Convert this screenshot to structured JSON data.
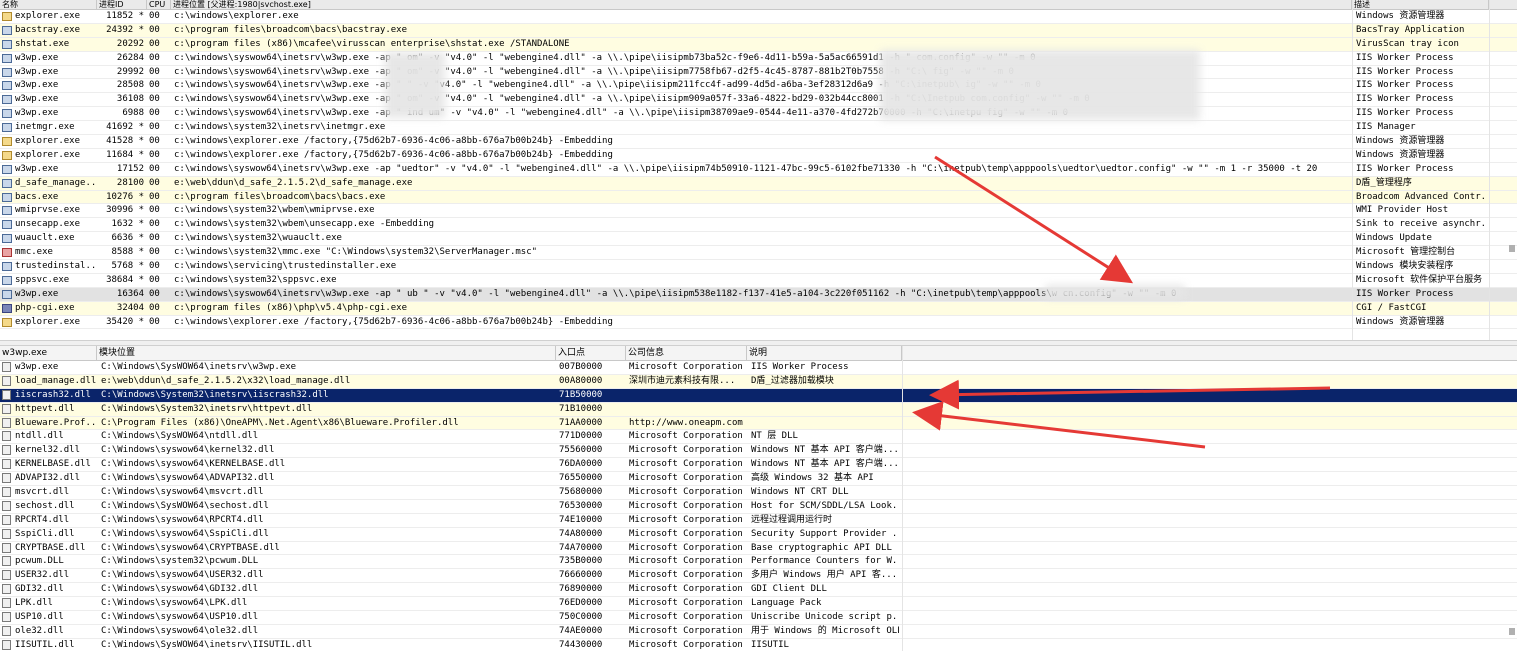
{
  "processes": {
    "columns": {
      "name": "名称",
      "pid": "进程ID",
      "cpu": "CPU",
      "path": "进程位置 [父进程:1980|svchost.exe]",
      "desc": "描述"
    },
    "rows": [
      {
        "icon": "explorer-icon",
        "name": "explorer.exe",
        "pid": "11852 *",
        "cpu": "00",
        "path": "c:\\windows\\explorer.exe",
        "desc": "Windows 资源管理器",
        "style": "normal"
      },
      {
        "icon": "bacstray-icon",
        "name": "bacstray.exe",
        "pid": "24392 *",
        "cpu": "00",
        "path": "c:\\program files\\broadcom\\bacs\\bacstray.exe",
        "desc": "BacsTray Application",
        "style": "svc"
      },
      {
        "icon": "shstat-icon",
        "name": "shstat.exe",
        "pid": "20292",
        "cpu": "00",
        "path": "c:\\program files (x86)\\mcafee\\virusscan enterprise\\shstat.exe /STANDALONE",
        "desc": "VirusScan tray icon",
        "style": "svc"
      },
      {
        "icon": "w3wp-icon",
        "name": "w3wp.exe",
        "pid": "26284",
        "cpu": "00",
        "path": "c:\\windows\\syswow64\\inetsrv\\w3wp.exe -ap \"     om\" -v \"v4.0\" -l \"webengine4.dll\" -a \\\\.\\pipe\\iisipmb73ba52c-f9e6-4d11-b59a-5a5ac66591d1 -h \"                                    com.config\" -w \"\" -m 0",
        "desc": "IIS Worker Process",
        "style": "normal"
      },
      {
        "icon": "w3wp-icon",
        "name": "w3wp.exe",
        "pid": "29992",
        "cpu": "00",
        "path": "c:\\windows\\syswow64\\inetsrv\\w3wp.exe -ap \"     om\" -v \"v4.0\" -l \"webengine4.dll\" -a \\\\.\\pipe\\iisipm7758fb67-d2f5-4c45-8787-881b2T0b7558 -h \"C:\\                                 fig\" -w \"\" -m 0",
        "desc": "IIS Worker Process",
        "style": "normal"
      },
      {
        "icon": "w3wp-icon",
        "name": "w3wp.exe",
        "pid": "28508",
        "cpu": "00",
        "path": "c:\\windows\\syswow64\\inetsrv\\w3wp.exe -ap \"      \" -v \"v4.0\" -l \"webengine4.dll\" -a \\\\.\\pipe\\iisipm211fcc4f-ad99-4d5d-a6ba-3ef28312d6a9 -h \"C:\\inetpub\\                          ig\" -w \"\" -m 0",
        "desc": "IIS Worker Process",
        "style": "normal"
      },
      {
        "icon": "w3wp-icon",
        "name": "w3wp.exe",
        "pid": "36108",
        "cpu": "00",
        "path": "c:\\windows\\syswow64\\inetsrv\\w3wp.exe -ap \"     om\" -v \"v4.0\" -l \"webengine4.dll\" -a \\\\.\\pipe\\iisipm909a057f-33a6-4822-bd29-032b44cc8001 -h \"C:\\Inetpub                        com.config\" -w \"\" -m 0",
        "desc": "IIS Worker Process",
        "style": "normal"
      },
      {
        "icon": "w3wp-icon",
        "name": "w3wp.exe",
        "pid": "6988",
        "cpu": "00",
        "path": "c:\\windows\\syswow64\\inetsrv\\w3wp.exe -ap \"   ind    um\" -v \"v4.0\" -l \"webengine4.dll\" -a \\\\.\\pipe\\iisipm38709ae9-0544-4e11-a370-4fd272b70000 -h \"C:\\inetpu                   fig\" -w \"\" -m 0",
        "desc": "IIS Worker Process",
        "style": "normal"
      },
      {
        "icon": "inetmgr-icon",
        "name": "inetmgr.exe",
        "pid": "41692 *",
        "cpu": "00",
        "path": "c:\\windows\\system32\\inetsrv\\inetmgr.exe",
        "desc": "IIS Manager",
        "style": "normal"
      },
      {
        "icon": "explorer-icon",
        "name": "explorer.exe",
        "pid": "41528 *",
        "cpu": "00",
        "path": "c:\\windows\\explorer.exe /factory,{75d62b7-6936-4c06-a8bb-676a7b00b24b} -Embedding",
        "desc": "Windows 资源管理器",
        "style": "normal"
      },
      {
        "icon": "explorer-icon",
        "name": "explorer.exe",
        "pid": "11684 *",
        "cpu": "00",
        "path": "c:\\windows\\explorer.exe /factory,{75d62b7-6936-4c06-a8bb-676a7b00b24b} -Embedding",
        "desc": "Windows 资源管理器",
        "style": "normal"
      },
      {
        "icon": "w3wp-icon",
        "name": "w3wp.exe",
        "pid": "17152",
        "cpu": "00",
        "path": "c:\\windows\\syswow64\\inetsrv\\w3wp.exe -ap \"uedtor\" -v \"v4.0\" -l \"webengine4.dll\" -a \\\\.\\pipe\\iisipm74b50910-1121-47bc-99c5-6102fbe71330 -h \"C:\\inetpub\\temp\\apppools\\uedtor\\uedtor.config\" -w \"\" -m 1 -r 35000 -t 20",
        "desc": "IIS Worker Process",
        "style": "normal"
      },
      {
        "icon": "dsafe-icon",
        "name": "d_safe_manage...",
        "pid": "28100",
        "cpu": "00",
        "path": "e:\\web\\ddun\\d_safe_2.1.5.2\\d_safe_manage.exe",
        "desc": "D盾_管理程序",
        "style": "svc"
      },
      {
        "icon": "bacs-icon",
        "name": "bacs.exe",
        "pid": "10276 *",
        "cpu": "00",
        "path": "c:\\program files\\broadcom\\bacs\\bacs.exe",
        "desc": "Broadcom Advanced Contr...",
        "style": "svc"
      },
      {
        "icon": "wmiprvse-icon",
        "name": "wmiprvse.exe",
        "pid": "30996 *",
        "cpu": "00",
        "path": "c:\\windows\\system32\\wbem\\wmiprvse.exe",
        "desc": "WMI Provider Host",
        "style": "normal"
      },
      {
        "icon": "unsecapp-icon",
        "name": "unsecapp.exe",
        "pid": "1632 *",
        "cpu": "00",
        "path": "c:\\windows\\system32\\wbem\\unsecapp.exe -Embedding",
        "desc": "Sink to receive asynchr...",
        "style": "normal"
      },
      {
        "icon": "wuauclt-icon",
        "name": "wuauclt.exe",
        "pid": "6636 *",
        "cpu": "00",
        "path": "c:\\windows\\system32\\wuauclt.exe",
        "desc": "Windows Update",
        "style": "normal"
      },
      {
        "icon": "mmc-icon",
        "name": "mmc.exe",
        "pid": "8588 *",
        "cpu": "00",
        "path": "c:\\windows\\system32\\mmc.exe \"C:\\Windows\\system32\\ServerManager.msc\"",
        "desc": "Microsoft 管理控制台",
        "style": "normal"
      },
      {
        "icon": "trustedinstaller-icon",
        "name": "trustedinstal...",
        "pid": "5768 *",
        "cpu": "00",
        "path": "c:\\windows\\servicing\\trustedinstaller.exe",
        "desc": "Windows 模块安装程序",
        "style": "normal"
      },
      {
        "icon": "sppsvc-icon",
        "name": "sppsvc.exe",
        "pid": "38684 *",
        "cpu": "00",
        "path": "c:\\windows\\system32\\sppsvc.exe",
        "desc": "Microsoft 软件保护平台服务",
        "style": "normal"
      },
      {
        "icon": "w3wp-icon",
        "name": "w3wp.exe",
        "pid": "16364",
        "cpu": "00",
        "path": "c:\\windows\\syswow64\\inetsrv\\w3wp.exe -ap \"    ub    \" -v \"v4.0\" -l \"webengine4.dll\" -a \\\\.\\pipe\\iisipm538e1182-f137-41e5-a104-3c220f051162 -h \"C:\\inetpub\\temp\\apppools\\w                         cn.config\" -w \"\" -m 0",
        "desc": "IIS Worker Process",
        "style": "sel"
      },
      {
        "icon": "php-icon",
        "name": "php-cgi.exe",
        "pid": "32404",
        "cpu": "00",
        "path": "c:\\program files (x86)\\php\\v5.4\\php-cgi.exe",
        "desc": "CGI / FastCGI",
        "style": "svc"
      },
      {
        "icon": "explorer-icon",
        "name": "explorer.exe",
        "pid": "35420 *",
        "cpu": "00",
        "path": "c:\\windows\\explorer.exe /factory,{75d62b7-6936-4c06-a8bb-676a7b00b24b} -Embedding",
        "desc": "Windows 资源管理器",
        "style": "normal"
      }
    ]
  },
  "modules": {
    "columns": {
      "name": "w3wp.exe",
      "path": "模块位置",
      "base": "入口点",
      "company": "公司信息",
      "desc": "说明"
    },
    "rows": [
      {
        "name": "w3wp.exe",
        "path": "C:\\Windows\\SysWOW64\\inetsrv\\w3wp.exe",
        "base": "007B0000",
        "company": "Microsoft Corporation",
        "desc": "IIS Worker Process",
        "style": "normal"
      },
      {
        "name": "load_manage.dll",
        "path": "e:\\web\\ddun\\d_safe_2.1.5.2\\x32\\load_manage.dll",
        "base": "00A80000",
        "company": "深圳市迪元素科技有限...",
        "desc": "D盾_过滤器加载模块",
        "style": "svc"
      },
      {
        "name": "iiscrash32.dll",
        "path": "C:\\Windows\\System32\\inetsrv\\iiscrash32.dll",
        "base": "71B50000",
        "company": "",
        "desc": "",
        "style": "selblue"
      },
      {
        "name": "httpevt.dll",
        "path": "C:\\Windows\\System32\\inetsrv\\httpevt.dll",
        "base": "71B10000",
        "company": "",
        "desc": "",
        "style": "svc"
      },
      {
        "name": "Blueware.Prof...",
        "path": "C:\\Program Files (x86)\\OneAPM\\.Net.Agent\\x86\\Blueware.Profiler.dll",
        "base": "71AA0000",
        "company": "http://www.oneapm.com",
        "desc": "",
        "style": "svc"
      },
      {
        "name": "ntdll.dll",
        "path": "C:\\Windows\\SysWOW64\\ntdll.dll",
        "base": "771D0000",
        "company": "Microsoft Corporation",
        "desc": "NT 层 DLL",
        "style": "normal"
      },
      {
        "name": "kernel32.dll",
        "path": "C:\\Windows\\syswow64\\kernel32.dll",
        "base": "75560000",
        "company": "Microsoft Corporation",
        "desc": "Windows NT 基本 API 客户端...",
        "style": "normal"
      },
      {
        "name": "KERNELBASE.dll",
        "path": "C:\\Windows\\syswow64\\KERNELBASE.dll",
        "base": "76DA0000",
        "company": "Microsoft Corporation",
        "desc": "Windows NT 基本 API 客户端...",
        "style": "normal"
      },
      {
        "name": "ADVAPI32.dll",
        "path": "C:\\Windows\\syswow64\\ADVAPI32.dll",
        "base": "76550000",
        "company": "Microsoft Corporation",
        "desc": "高级 Windows 32 基本 API",
        "style": "normal"
      },
      {
        "name": "msvcrt.dll",
        "path": "C:\\Windows\\syswow64\\msvcrt.dll",
        "base": "75680000",
        "company": "Microsoft Corporation",
        "desc": "Windows NT CRT DLL",
        "style": "normal"
      },
      {
        "name": "sechost.dll",
        "path": "C:\\Windows\\SysWOW64\\sechost.dll",
        "base": "76530000",
        "company": "Microsoft Corporation",
        "desc": "Host for SCM/SDDL/LSA Look...",
        "style": "normal"
      },
      {
        "name": "RPCRT4.dll",
        "path": "C:\\Windows\\syswow64\\RPCRT4.dll",
        "base": "74E10000",
        "company": "Microsoft Corporation",
        "desc": "远程过程调用运行时",
        "style": "normal"
      },
      {
        "name": "SspiCli.dll",
        "path": "C:\\Windows\\syswow64\\SspiCli.dll",
        "base": "74A80000",
        "company": "Microsoft Corporation",
        "desc": "Security Support Provider ...",
        "style": "normal"
      },
      {
        "name": "CRYPTBASE.dll",
        "path": "C:\\Windows\\syswow64\\CRYPTBASE.dll",
        "base": "74A70000",
        "company": "Microsoft Corporation",
        "desc": "Base cryptographic API DLL",
        "style": "normal"
      },
      {
        "name": "pcwum.DLL",
        "path": "C:\\Windows\\system32\\pcwum.DLL",
        "base": "735B0000",
        "company": "Microsoft Corporation",
        "desc": "Performance Counters for W...",
        "style": "normal"
      },
      {
        "name": "USER32.dll",
        "path": "C:\\Windows\\syswow64\\USER32.dll",
        "base": "76660000",
        "company": "Microsoft Corporation",
        "desc": "多用户 Windows 用户 API 客...",
        "style": "normal"
      },
      {
        "name": "GDI32.dll",
        "path": "C:\\Windows\\syswow64\\GDI32.dll",
        "base": "76890000",
        "company": "Microsoft Corporation",
        "desc": "GDI Client DLL",
        "style": "normal"
      },
      {
        "name": "LPK.dll",
        "path": "C:\\Windows\\syswow64\\LPK.dll",
        "base": "76ED0000",
        "company": "Microsoft Corporation",
        "desc": "Language Pack",
        "style": "normal"
      },
      {
        "name": "USP10.dll",
        "path": "C:\\Windows\\syswow64\\USP10.dll",
        "base": "750C0000",
        "company": "Microsoft Corporation",
        "desc": "Uniscribe Unicode script p...",
        "style": "normal"
      },
      {
        "name": "ole32.dll",
        "path": "C:\\Windows\\syswow64\\ole32.dll",
        "base": "74AE0000",
        "company": "Microsoft Corporation",
        "desc": "用于 Windows 的 Microsoft OLE",
        "style": "normal"
      },
      {
        "name": "IISUTIL.dll",
        "path": "C:\\Windows\\SysWOW64\\inetsrv\\IISUTIL.dll",
        "base": "74430000",
        "company": "Microsoft Corporation",
        "desc": "IISUTIL",
        "style": "normal"
      }
    ]
  },
  "annotations": {
    "arrow_color": "#e53935"
  },
  "colors": {
    "service_row": "#fffde1",
    "selected_row": "#e2e2e2",
    "selected_blue": "#0a246a"
  }
}
